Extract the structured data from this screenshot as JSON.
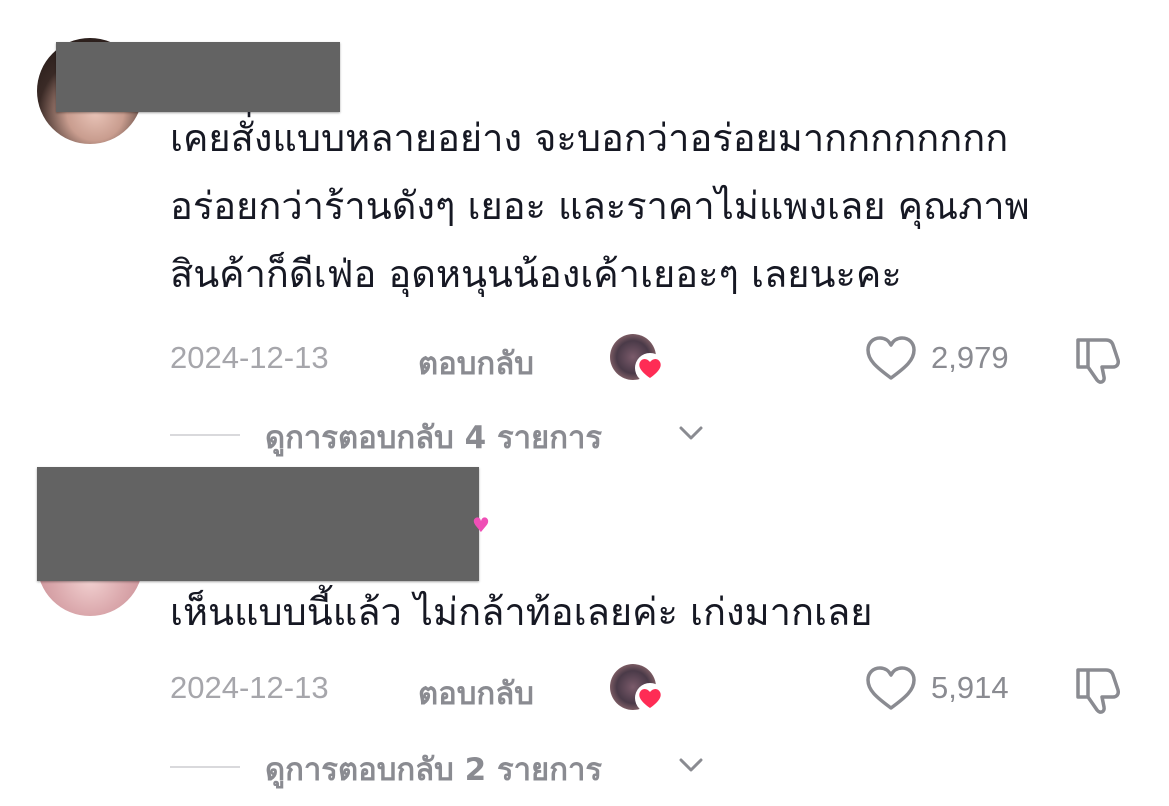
{
  "comments": [
    {
      "text": "เคยสั่งแบบหลายอย่าง จะบอกว่าอร่อยมากกกกกกกก\nอร่อยกว่าร้านดังๆ เยอะ และราคาไม่แพงเลย คุณภาพ\nสินค้าก็ดีเฟ่อ อุดหนุนน้องเค้าเยอะๆ เลยนะคะ",
      "date": "2024-12-13",
      "reply_label": "ตอบกลับ",
      "like_count": "2,979",
      "view_replies_label": "ดูการตอบกลับ 4 รายการ"
    },
    {
      "text": "เห็นแบบนี้แล้ว ไม่กล้าท้อเลยค่ะ เก่งมากเลย",
      "date": "2024-12-13",
      "reply_label": "ตอบกลับ",
      "like_count": "5,914",
      "view_replies_label": "ดูการตอบกลับ 2 รายการ"
    }
  ],
  "icons": {
    "like": "heart-outline-icon",
    "dislike": "thumbs-down-outline-icon",
    "creator_liked": "creator-heart-badge-icon",
    "expand": "chevron-down-icon"
  },
  "colors": {
    "text_primary": "#161823",
    "text_secondary": "#8a8b91",
    "date": "#a6a6ab",
    "heart_badge": "#fe2c55"
  }
}
